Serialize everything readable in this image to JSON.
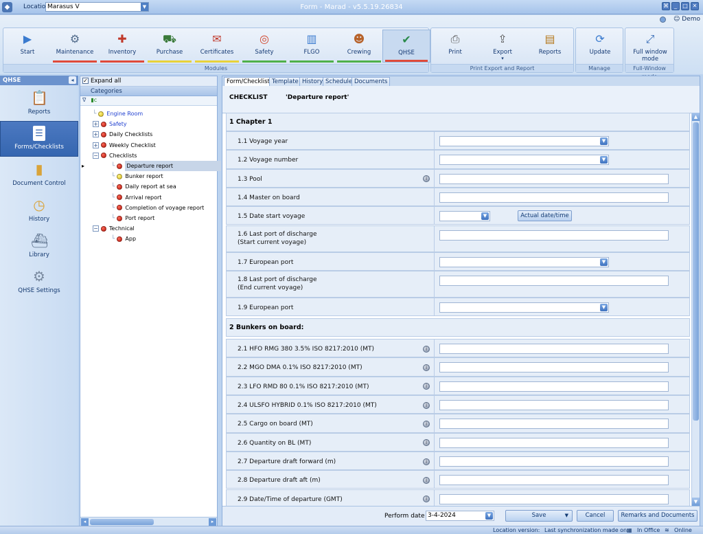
{
  "window": {
    "title": "Form - Marad - v5.5.19.26834",
    "location_label": "Location",
    "location_value": "Marasus V",
    "user": "Demo"
  },
  "ribbon": {
    "modules_group": "Modules",
    "modules": [
      {
        "label": "Start",
        "icon": "play-icon",
        "bar": ""
      },
      {
        "label": "Maintenance",
        "icon": "maintenance-icon",
        "bar": "#e04a3a"
      },
      {
        "label": "Inventory",
        "icon": "inventory-icon",
        "bar": "#e04a3a"
      },
      {
        "label": "Purchase",
        "icon": "cart-icon",
        "bar": "#e8d23a"
      },
      {
        "label": "Certificates",
        "icon": "certificate-icon",
        "bar": "#e8d23a"
      },
      {
        "label": "Safety",
        "icon": "lifebuoy-icon",
        "bar": "#4fb04a"
      },
      {
        "label": "FLGO",
        "icon": "bar-chart-icon",
        "bar": "#4fb04a"
      },
      {
        "label": "Crewing",
        "icon": "crew-icon",
        "bar": "#4fb04a"
      },
      {
        "label": "QHSE",
        "icon": "qhse-check-icon",
        "bar": "#e04a3a"
      }
    ],
    "print_group": "Print Export and Report",
    "print_buttons": [
      {
        "label": "Print",
        "icon": "printer-icon"
      },
      {
        "label": "Export",
        "icon": "export-icon"
      },
      {
        "label": "Reports",
        "icon": "reports-icon"
      }
    ],
    "manage_group": "Manage",
    "update_label": "Update",
    "fullwindow_group": "Full-Window mode",
    "fullwindow_label": "Full window mode"
  },
  "leftnav": {
    "header": "QHSE",
    "items": [
      {
        "label": "Reports",
        "icon": "clipboard-icon"
      },
      {
        "label": "Forms/Checklists",
        "icon": "forms-icon"
      },
      {
        "label": "Document Control",
        "icon": "folder-icon"
      },
      {
        "label": "History",
        "icon": "history-icon"
      },
      {
        "label": "Library",
        "icon": "library-icon"
      },
      {
        "label": "QHSE Settings",
        "icon": "gear-icon"
      }
    ]
  },
  "tree": {
    "expand_all": "Expand all",
    "categories_header": "Categories",
    "filter_symbol": "∇",
    "nodes": [
      {
        "label": "Engine Room",
        "status": "yellow",
        "level": 1,
        "link": true
      },
      {
        "label": "Safety",
        "status": "red",
        "level": 0,
        "link": true,
        "expander": "+"
      },
      {
        "label": "Daily Checklists",
        "status": "red",
        "level": 0,
        "expander": "+"
      },
      {
        "label": "Weekly Checklist",
        "status": "red",
        "level": 0,
        "expander": "+"
      },
      {
        "label": "Checklists",
        "status": "red",
        "level": 0,
        "expander": "-"
      },
      {
        "label": "Departure report",
        "status": "red",
        "level": 1,
        "selected": true
      },
      {
        "label": "Bunker report",
        "status": "yellow",
        "level": 1
      },
      {
        "label": "Daily report at sea",
        "status": "red",
        "level": 1
      },
      {
        "label": "Arrival report",
        "status": "red",
        "level": 1
      },
      {
        "label": "Completion of voyage report",
        "status": "red",
        "level": 1
      },
      {
        "label": "Port report",
        "status": "red",
        "level": 1
      },
      {
        "label": "Technical",
        "status": "red",
        "level": 0,
        "expander": "-"
      },
      {
        "label": "App",
        "status": "red",
        "level": 1
      }
    ]
  },
  "tabs": [
    "Form/Checklist",
    "Template",
    "History",
    "Schedule",
    "Documents"
  ],
  "checklist": {
    "label": "CHECKLIST",
    "name": "'Departure report'"
  },
  "sections": [
    {
      "title": "1 Chapter 1"
    },
    {
      "title": "2 Bunkers on board:"
    }
  ],
  "questions": [
    {
      "label": "1.1 Voyage year",
      "type": "select"
    },
    {
      "label": "1.2 Voyage number",
      "type": "select"
    },
    {
      "label": "1.3 Pool",
      "type": "text",
      "info": true
    },
    {
      "label": "1.4 Master on board",
      "type": "text"
    },
    {
      "label": "1.5 Date start voyage",
      "type": "date",
      "button": "Actual date/time"
    },
    {
      "label": "1.6 Last port of discharge",
      "label2": "(Start current voyage)",
      "type": "text"
    },
    {
      "label": "1.7 European port",
      "type": "select"
    },
    {
      "label": "1.8 Last port of discharge",
      "label2": "(End current voyage)",
      "type": "text"
    },
    {
      "label": "1.9 European port",
      "type": "select"
    },
    {
      "label": "2.1 HFO RMG 380 3.5% ISO 8217:2010  (MT)",
      "type": "text",
      "info": true
    },
    {
      "label": "2.2 MGO DMA 0.1% ISO 8217:2010 (MT)",
      "type": "text",
      "info": true
    },
    {
      "label": "2.3 LFO RMD 80 0.1% ISO 8217:2010  (MT)",
      "type": "text",
      "info": true
    },
    {
      "label": "2.4 ULSFO HYBRID 0.1% ISO 8217:2010 (MT)",
      "type": "text",
      "info": true
    },
    {
      "label": "2.5 Cargo on board  (MT)",
      "type": "text",
      "info": true
    },
    {
      "label": "2.6 Quantity on BL  (MT)",
      "type": "text",
      "info": true
    },
    {
      "label": "2.7 Departure draft forward (m)",
      "type": "text",
      "info": true
    },
    {
      "label": "2.8 Departure draft aft (m)",
      "type": "text",
      "info": true
    },
    {
      "label": "2.9 Date/Time of departure (GMT)",
      "type": "text",
      "info": true
    }
  ],
  "footer": {
    "perform_date_label": "Perform date",
    "perform_date_value": "3-4-2024",
    "save": "Save",
    "cancel": "Cancel",
    "remarks": "Remarks and Documents"
  },
  "status": {
    "location_version": "Location version:",
    "sync": "Last synchronization made on:",
    "office": "In Office",
    "online": "Online"
  }
}
